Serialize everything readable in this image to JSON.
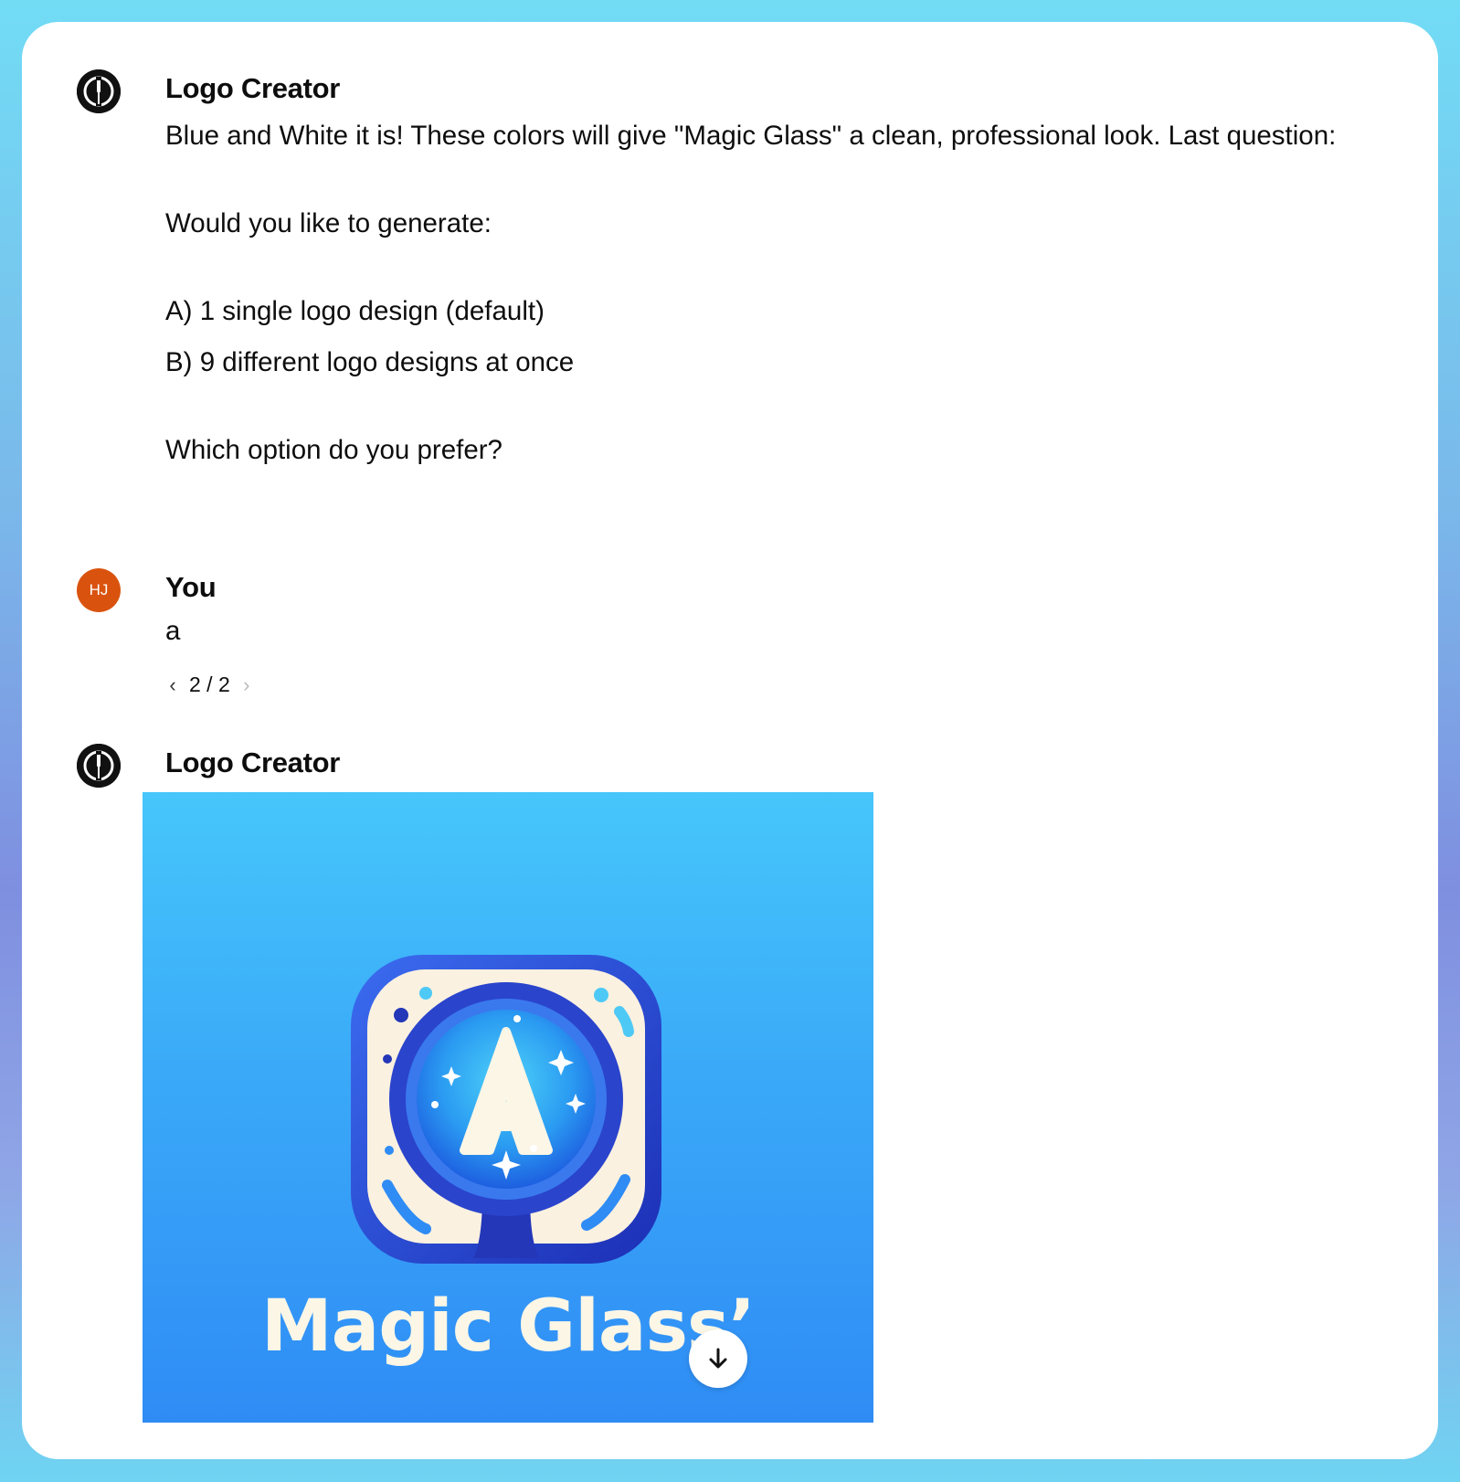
{
  "messages": [
    {
      "author": "Logo Creator",
      "lines": [
        "Blue and White it is! These colors will give \"Magic Glass\" a clean, professional look. Last question:",
        "Would you like to generate:",
        "A) 1 single logo design (default)",
        "B) 9 different logo designs at once",
        "Which option do you prefer?"
      ]
    },
    {
      "author": "You",
      "avatar_initials": "HJ",
      "text": "a",
      "pager": {
        "current": "2 / 2",
        "prev_icon": "chevron-left",
        "next_icon": "chevron-right"
      }
    },
    {
      "author": "Logo Creator",
      "image": {
        "text": "Magic Glass’",
        "emblem_letter": "A"
      }
    }
  ],
  "colors": {
    "user_avatar": "#d9530f",
    "bot_avatar": "#111111",
    "image_top": "#46c6fb",
    "image_bottom": "#2f8cf5"
  },
  "icons": {
    "bot_avatar": "paintbrush-logo-icon",
    "download": "arrow-down-icon"
  }
}
